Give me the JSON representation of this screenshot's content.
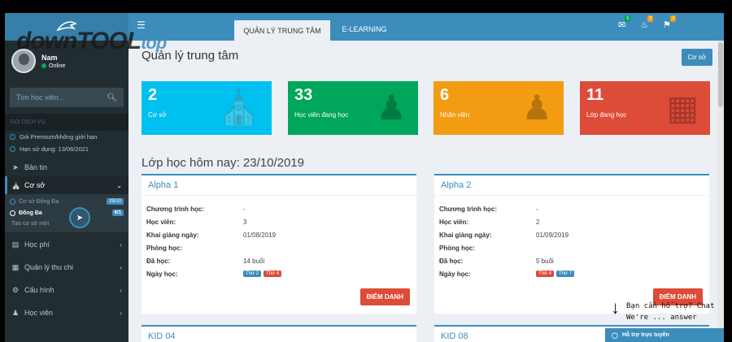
{
  "sidebar": {
    "user_name": "Nam",
    "user_status": "Online",
    "search_placeholder": "Tìm học viên...",
    "section_header": "GÓI DỊCH VỤ",
    "service_items": [
      "Gói Premium/không giới hạn",
      "Hạn sử dụng: 13/06/2021"
    ],
    "menu": {
      "news": "Bản tin",
      "campus": "Cơ sở",
      "tuition": "Học phí",
      "finance": "Quản lý thu chi",
      "settings": "Cấu hình",
      "students": "Học viên"
    },
    "campus_sub": [
      {
        "label": "Cơ sở Đống Đa",
        "badge": "29/10"
      },
      {
        "label": "Đống Đa",
        "badge": "6/1"
      }
    ],
    "create_campus": "Tạo cơ sở mới"
  },
  "topbar": {
    "tabs": [
      "QUẢN LÝ TRUNG TÂM",
      "E-LEARNING"
    ],
    "icon_badges": [
      "5",
      "2",
      "3"
    ]
  },
  "main": {
    "page_title": "Quản lý trung tâm",
    "campus_button": "Cơ sở",
    "stats": [
      {
        "value": "2",
        "label": "Cơ sở"
      },
      {
        "value": "33",
        "label": "Học viên đang học"
      },
      {
        "value": "6",
        "label": "Nhân viên"
      },
      {
        "value": "11",
        "label": "Lớp đang học"
      }
    ],
    "today_heading": "Lớp học hôm nay: 23/10/2019",
    "labels": {
      "program": "Chương trình học:",
      "students": "Học viên:",
      "start": "Khai giảng ngày:",
      "room": "Phòng học:",
      "done": "Đã học:",
      "days": "Ngày học:"
    },
    "classes": [
      {
        "name": "Alpha 1",
        "program": "-",
        "students": "3",
        "start": "01/08/2019",
        "room": "",
        "done": "14 buổi",
        "days": [
          "Thứ 2",
          "Thứ 4"
        ]
      },
      {
        "name": "Alpha 2",
        "program": "-",
        "students": "2",
        "start": "01/09/2019",
        "room": "",
        "done": "5 buổi",
        "days": [
          "Thứ 4",
          "Thứ 7"
        ]
      }
    ],
    "attendance_button": "ĐIỂM DANH",
    "more_classes": [
      "KID 04",
      "KID 08"
    ]
  },
  "support": {
    "tab_label": "Hỗ trợ trực tuyến",
    "hint_line1": "Bạn cần hỗ trợ? Chat",
    "hint_line2": "We're ... answer"
  },
  "watermark": {
    "a": "down",
    "b": "TOOL",
    "c": "top"
  },
  "colors": {
    "accent": "#3c8dbc",
    "sidebar": "#222d32",
    "aqua": "#00c0ef",
    "green": "#00a65a",
    "orange": "#f39c12",
    "red": "#dd4b39"
  }
}
